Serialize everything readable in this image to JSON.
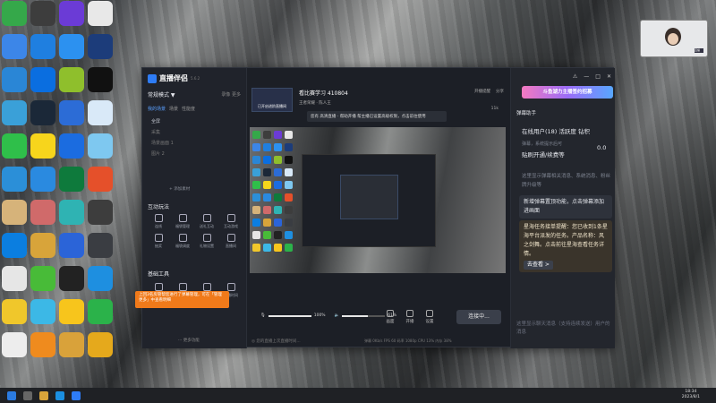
{
  "desktop": {
    "icon_colors": [
      "#35a84a",
      "#3d3d3d",
      "#6b3bd6",
      "#e8e8e8",
      "#3c86e8",
      "#1f7fe0",
      "#2c91f0",
      "#1c3c7a",
      "#2a86d6",
      "#0a6ee0",
      "#8fbf2c",
      "#111111",
      "#3aa0d8",
      "#1b2838",
      "#2c6cd6",
      "#d9e9f8",
      "#2fbf4a",
      "#f7d51c",
      "#1b6ce0",
      "#7ec8f0",
      "#2b8fd8",
      "#2a8ae0",
      "#0e7a3c",
      "#e5502a",
      "#d6b37a",
      "#d06a6a",
      "#2fb3b3",
      "#3d3d3d",
      "#0b7ee0",
      "#d8a43a",
      "#2b64d8",
      "#3a3d42",
      "#e6e6e6",
      "#48bb38",
      "#222222",
      "#1e8fe0",
      "#f0c72b",
      "#3cb8e6",
      "#f7c51c",
      "#2bb24a",
      "#ededed",
      "#ef8b1e",
      "#d9a23a",
      "#e5a91c"
    ],
    "labels": [
      "",
      "",
      "",
      "",
      "",
      "",
      "",
      "",
      "",
      "",
      "",
      "",
      "",
      "",
      "",
      "",
      "",
      "",
      "",
      "",
      "",
      "",
      "",
      "",
      "",
      "",
      "",
      "",
      "",
      "",
      "",
      "",
      "",
      "",
      "",
      "",
      "",
      "",
      "",
      "",
      "",
      "",
      "",
      ""
    ]
  },
  "taskbar": {
    "time": "18:34",
    "date": "2023/8/1"
  },
  "webcam": {
    "label": "直播"
  },
  "app": {
    "brand": "直播伴侣",
    "version": "5.6.2",
    "mode": "常规模式 ▼",
    "mode_right_1": "录像",
    "mode_right_2": "更多",
    "scene_tabs": [
      "我的场景",
      "场景",
      "性能度"
    ],
    "scenes": [
      "全屏",
      "采集",
      "场景画面 1",
      "图片 2"
    ],
    "add_material": "+ 添加素材",
    "section_interact": "互动玩法",
    "tools_interact": [
      "连线",
      "福袋管理",
      "送礼互动",
      "互动游戏",
      "抽奖",
      "福袋调度",
      "礼物设置",
      "直播间"
    ],
    "section_basic": "基础工具",
    "tools_basic": [
      "美颜",
      "话题",
      "直播中",
      "下播时间"
    ],
    "toast": "上回3名房管帮您进行了弹幕管理，可在「管理更多」中查看明细",
    "more_func": "··· 更多功能"
  },
  "center": {
    "thumb_title": "已开启进阶直播间",
    "stream_title": "看比赛学习 410804",
    "stream_sub": "王者荣耀 · 陈人王",
    "top_right": [
      "开播提醒",
      "分享"
    ],
    "notice": "您有 高清直播 · 帮助开播 帮主播已设置高级权限，点击前往使用",
    "likes": "11k",
    "mic_label": "100%",
    "speaker_label": "61%",
    "mic_level": 1.0,
    "speaker_level": 0.61,
    "ctrl_labels": [
      "麦克风",
      "扬声器",
      "画面",
      "开播",
      "设置"
    ],
    "connect": "连接中...",
    "status": "◎ 您的直播上次直播时间...",
    "stats": "弹幕 0Kb/s   FPS 60   码率 1080p   CPU 13%   内存 38%"
  },
  "right": {
    "win_icons": [
      "⚠",
      "—",
      "□",
      "✕"
    ],
    "banner": "斗鱼湖力主播签约招募",
    "panel_title": "弹幕助手",
    "online": "在线用户(18)   活跃度   钻积",
    "muted1": "弹幕，系统提示后可",
    "score": "0.0",
    "line_a": "贴刷开通/续费等",
    "muted2": "这里显示弹幕相关消息、系统消息、粉丝牌升级等",
    "card_a": "新增弹幕置顶功能，点击弹幕添加进画面",
    "card_b": "星海任务接单提醒：您已收到1条星海平台派发的任务。产品名称：风之剑舞。点击前往星海查看任务详情。",
    "go_btn": "去查看 >",
    "input_hint": "这里显示聊天消息（支持连续发送）用户的消息"
  }
}
